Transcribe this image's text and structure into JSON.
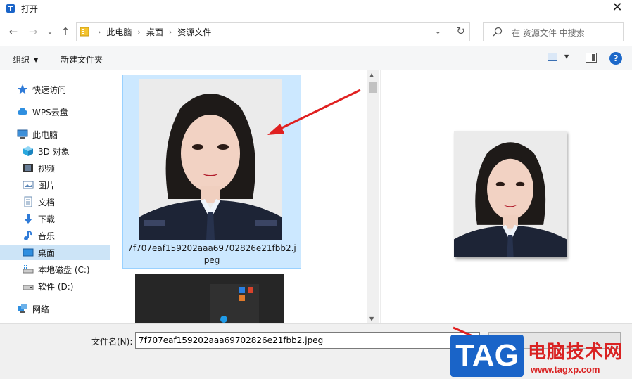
{
  "window": {
    "title": "打开",
    "close_glyph": "✕"
  },
  "nav": {
    "back_glyph": "←",
    "forward_glyph": "→",
    "recent_glyph": "⌄",
    "up_glyph": "↑",
    "breadcrumbs": [
      "此电脑",
      "桌面",
      "资源文件"
    ],
    "separator": "›",
    "dropdown_glyph": "⌄",
    "refresh_glyph": "↻",
    "search_placeholder": "在 资源文件 中搜索"
  },
  "commands": {
    "organize_label": "组织",
    "organize_caret": "▼",
    "new_folder_label": "新建文件夹",
    "view_caret": "▼",
    "help_label": "?"
  },
  "sidebar": {
    "items": [
      {
        "label": "快速访问",
        "icon": "star-icon"
      },
      {
        "label": "WPS云盘",
        "icon": "cloud-icon"
      },
      {
        "label": "此电脑",
        "icon": "computer-icon"
      },
      {
        "label": "3D 对象",
        "icon": "cube-icon"
      },
      {
        "label": "视频",
        "icon": "video-icon"
      },
      {
        "label": "图片",
        "icon": "picture-icon"
      },
      {
        "label": "文档",
        "icon": "document-icon"
      },
      {
        "label": "下载",
        "icon": "download-icon"
      },
      {
        "label": "音乐",
        "icon": "music-icon"
      },
      {
        "label": "桌面",
        "icon": "desktop-icon",
        "selected": true
      },
      {
        "label": "本地磁盘 (C:)",
        "icon": "drive-icon"
      },
      {
        "label": "软件 (D:)",
        "icon": "drive-icon"
      },
      {
        "label": "网络",
        "icon": "network-icon"
      }
    ]
  },
  "files": [
    {
      "name": "7f707eaf159202aaa69702826e21fbb2.jpeg",
      "selected": true
    },
    {
      "name": "",
      "selected": false
    }
  ],
  "scrollbar": {
    "up_glyph": "▲",
    "down_glyph": "▼"
  },
  "bottom": {
    "filename_label": "文件名(N):",
    "filename_value": "7f707eaf159202aaa69702826e21fbb2.jpeg"
  },
  "watermark": {
    "tag": "TAG",
    "text": "电脑技术网",
    "url": "www.tagxp.com"
  },
  "colors": {
    "selection": "#cce8ff",
    "accent": "#1c68c9",
    "arrow": "#e02020"
  }
}
